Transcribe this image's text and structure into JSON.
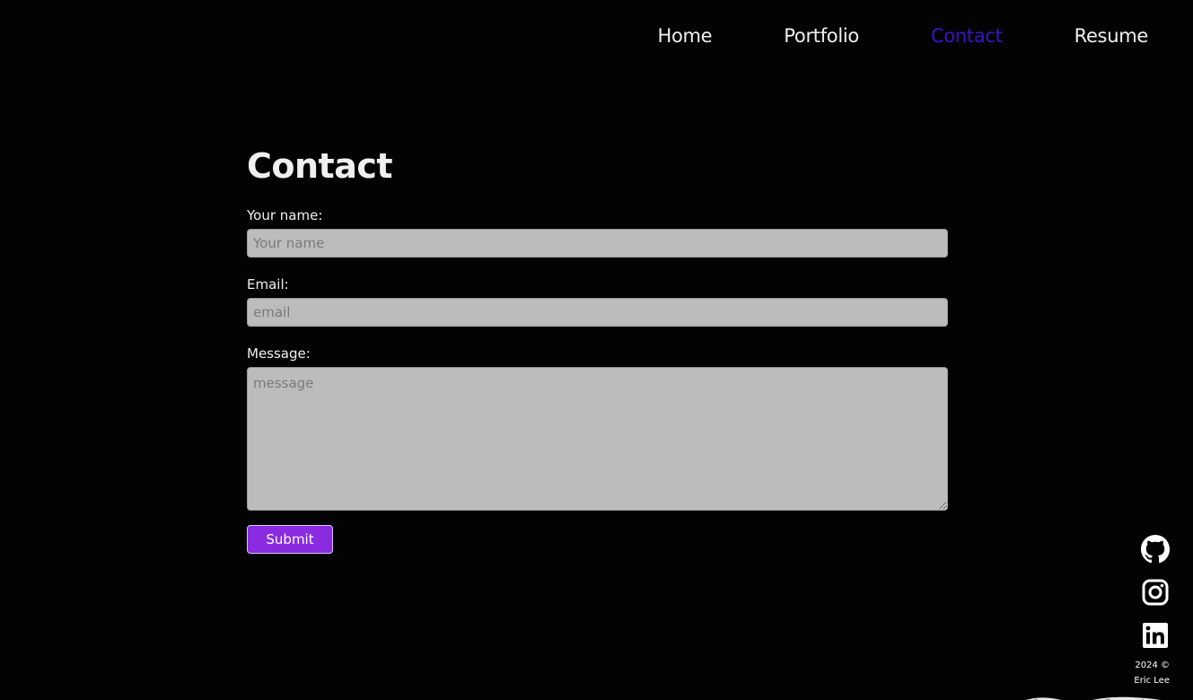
{
  "nav": {
    "items": [
      {
        "label": "Home",
        "active": false
      },
      {
        "label": "Portfolio",
        "active": false
      },
      {
        "label": "Contact",
        "active": true
      },
      {
        "label": "Resume",
        "active": false
      }
    ],
    "active_color": "#3a12c9"
  },
  "form": {
    "title": "Contact",
    "name_label": "Your name:",
    "name_placeholder": "Your name",
    "name_value": "",
    "email_label": "Email:",
    "email_placeholder": "email",
    "email_value": "",
    "message_label": "Message:",
    "message_placeholder": "message",
    "message_value": "",
    "submit_label": "Submit",
    "submit_color": "#8a2be2"
  },
  "social": {
    "icons": [
      "github-icon",
      "instagram-icon",
      "linkedin-icon"
    ]
  },
  "footer": {
    "line1": "2024 ©",
    "line2": "Eric Lee"
  }
}
